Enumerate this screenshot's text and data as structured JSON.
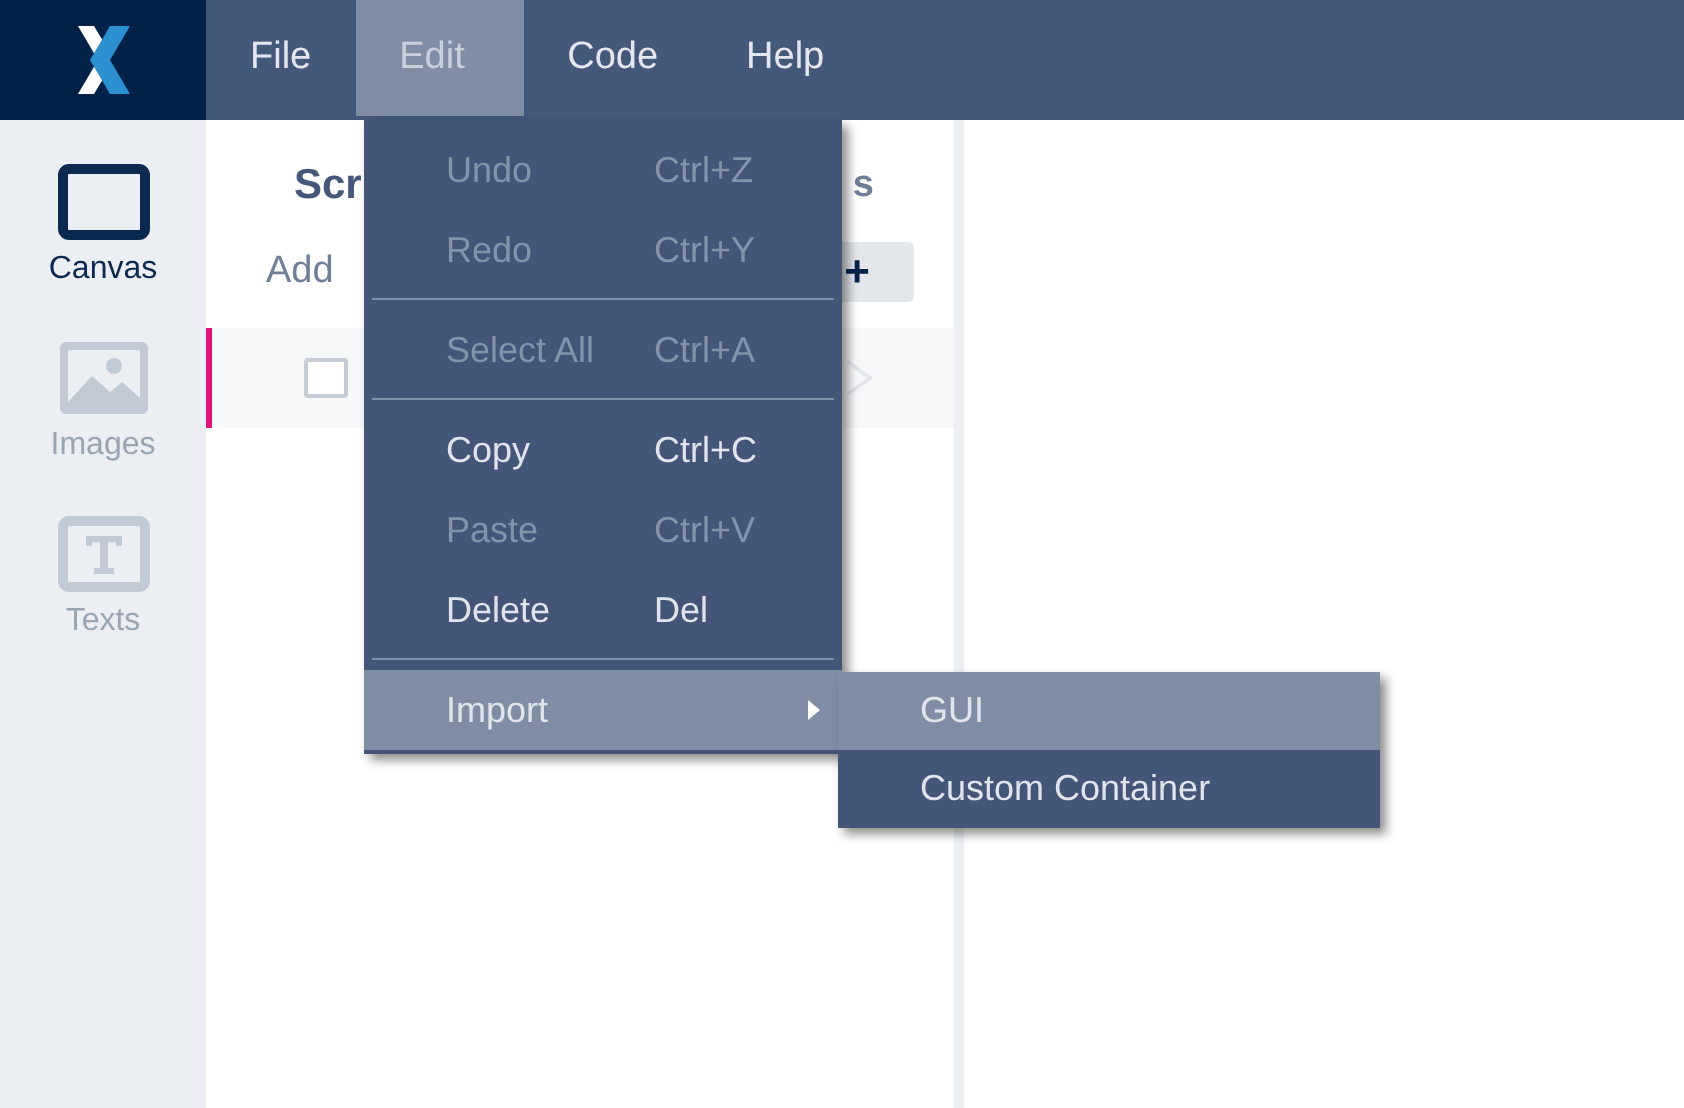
{
  "menu_bar": {
    "items": [
      {
        "label": "File",
        "selected": false
      },
      {
        "label": "Edit",
        "selected": true
      },
      {
        "label": "Code",
        "selected": false
      },
      {
        "label": "Help",
        "selected": false
      }
    ]
  },
  "sidebar": {
    "items": [
      {
        "label": "Canvas",
        "selected": true,
        "kind": "canvas"
      },
      {
        "label": "Images",
        "selected": false,
        "kind": "images"
      },
      {
        "label": "Texts",
        "selected": false,
        "kind": "texts"
      }
    ]
  },
  "panel": {
    "title": "Scr",
    "title_end": "s",
    "add_label": "Add",
    "add_button": "+",
    "row": {
      "selected": true,
      "checked": false
    }
  },
  "edit_menu": {
    "items": [
      {
        "kind": "item",
        "label": "Undo",
        "shortcut": "Ctrl+Z",
        "disabled": true,
        "highlighted": false
      },
      {
        "kind": "item",
        "label": "Redo",
        "shortcut": "Ctrl+Y",
        "disabled": true,
        "highlighted": false
      },
      {
        "kind": "separator"
      },
      {
        "kind": "item",
        "label": "Select All",
        "shortcut": "Ctrl+A",
        "disabled": true,
        "highlighted": false
      },
      {
        "kind": "separator"
      },
      {
        "kind": "item",
        "label": "Copy",
        "shortcut": "Ctrl+C",
        "disabled": false,
        "highlighted": false
      },
      {
        "kind": "item",
        "label": "Paste",
        "shortcut": "Ctrl+V",
        "disabled": true,
        "highlighted": false
      },
      {
        "kind": "item",
        "label": "Delete",
        "shortcut": "Del",
        "disabled": false,
        "highlighted": false
      },
      {
        "kind": "separator"
      },
      {
        "kind": "submenu",
        "label": "Import",
        "disabled": false,
        "highlighted": true
      }
    ]
  },
  "import_submenu": {
    "items": [
      {
        "label": "GUI",
        "highlighted": true
      },
      {
        "label": "Custom Container",
        "highlighted": false
      }
    ]
  }
}
